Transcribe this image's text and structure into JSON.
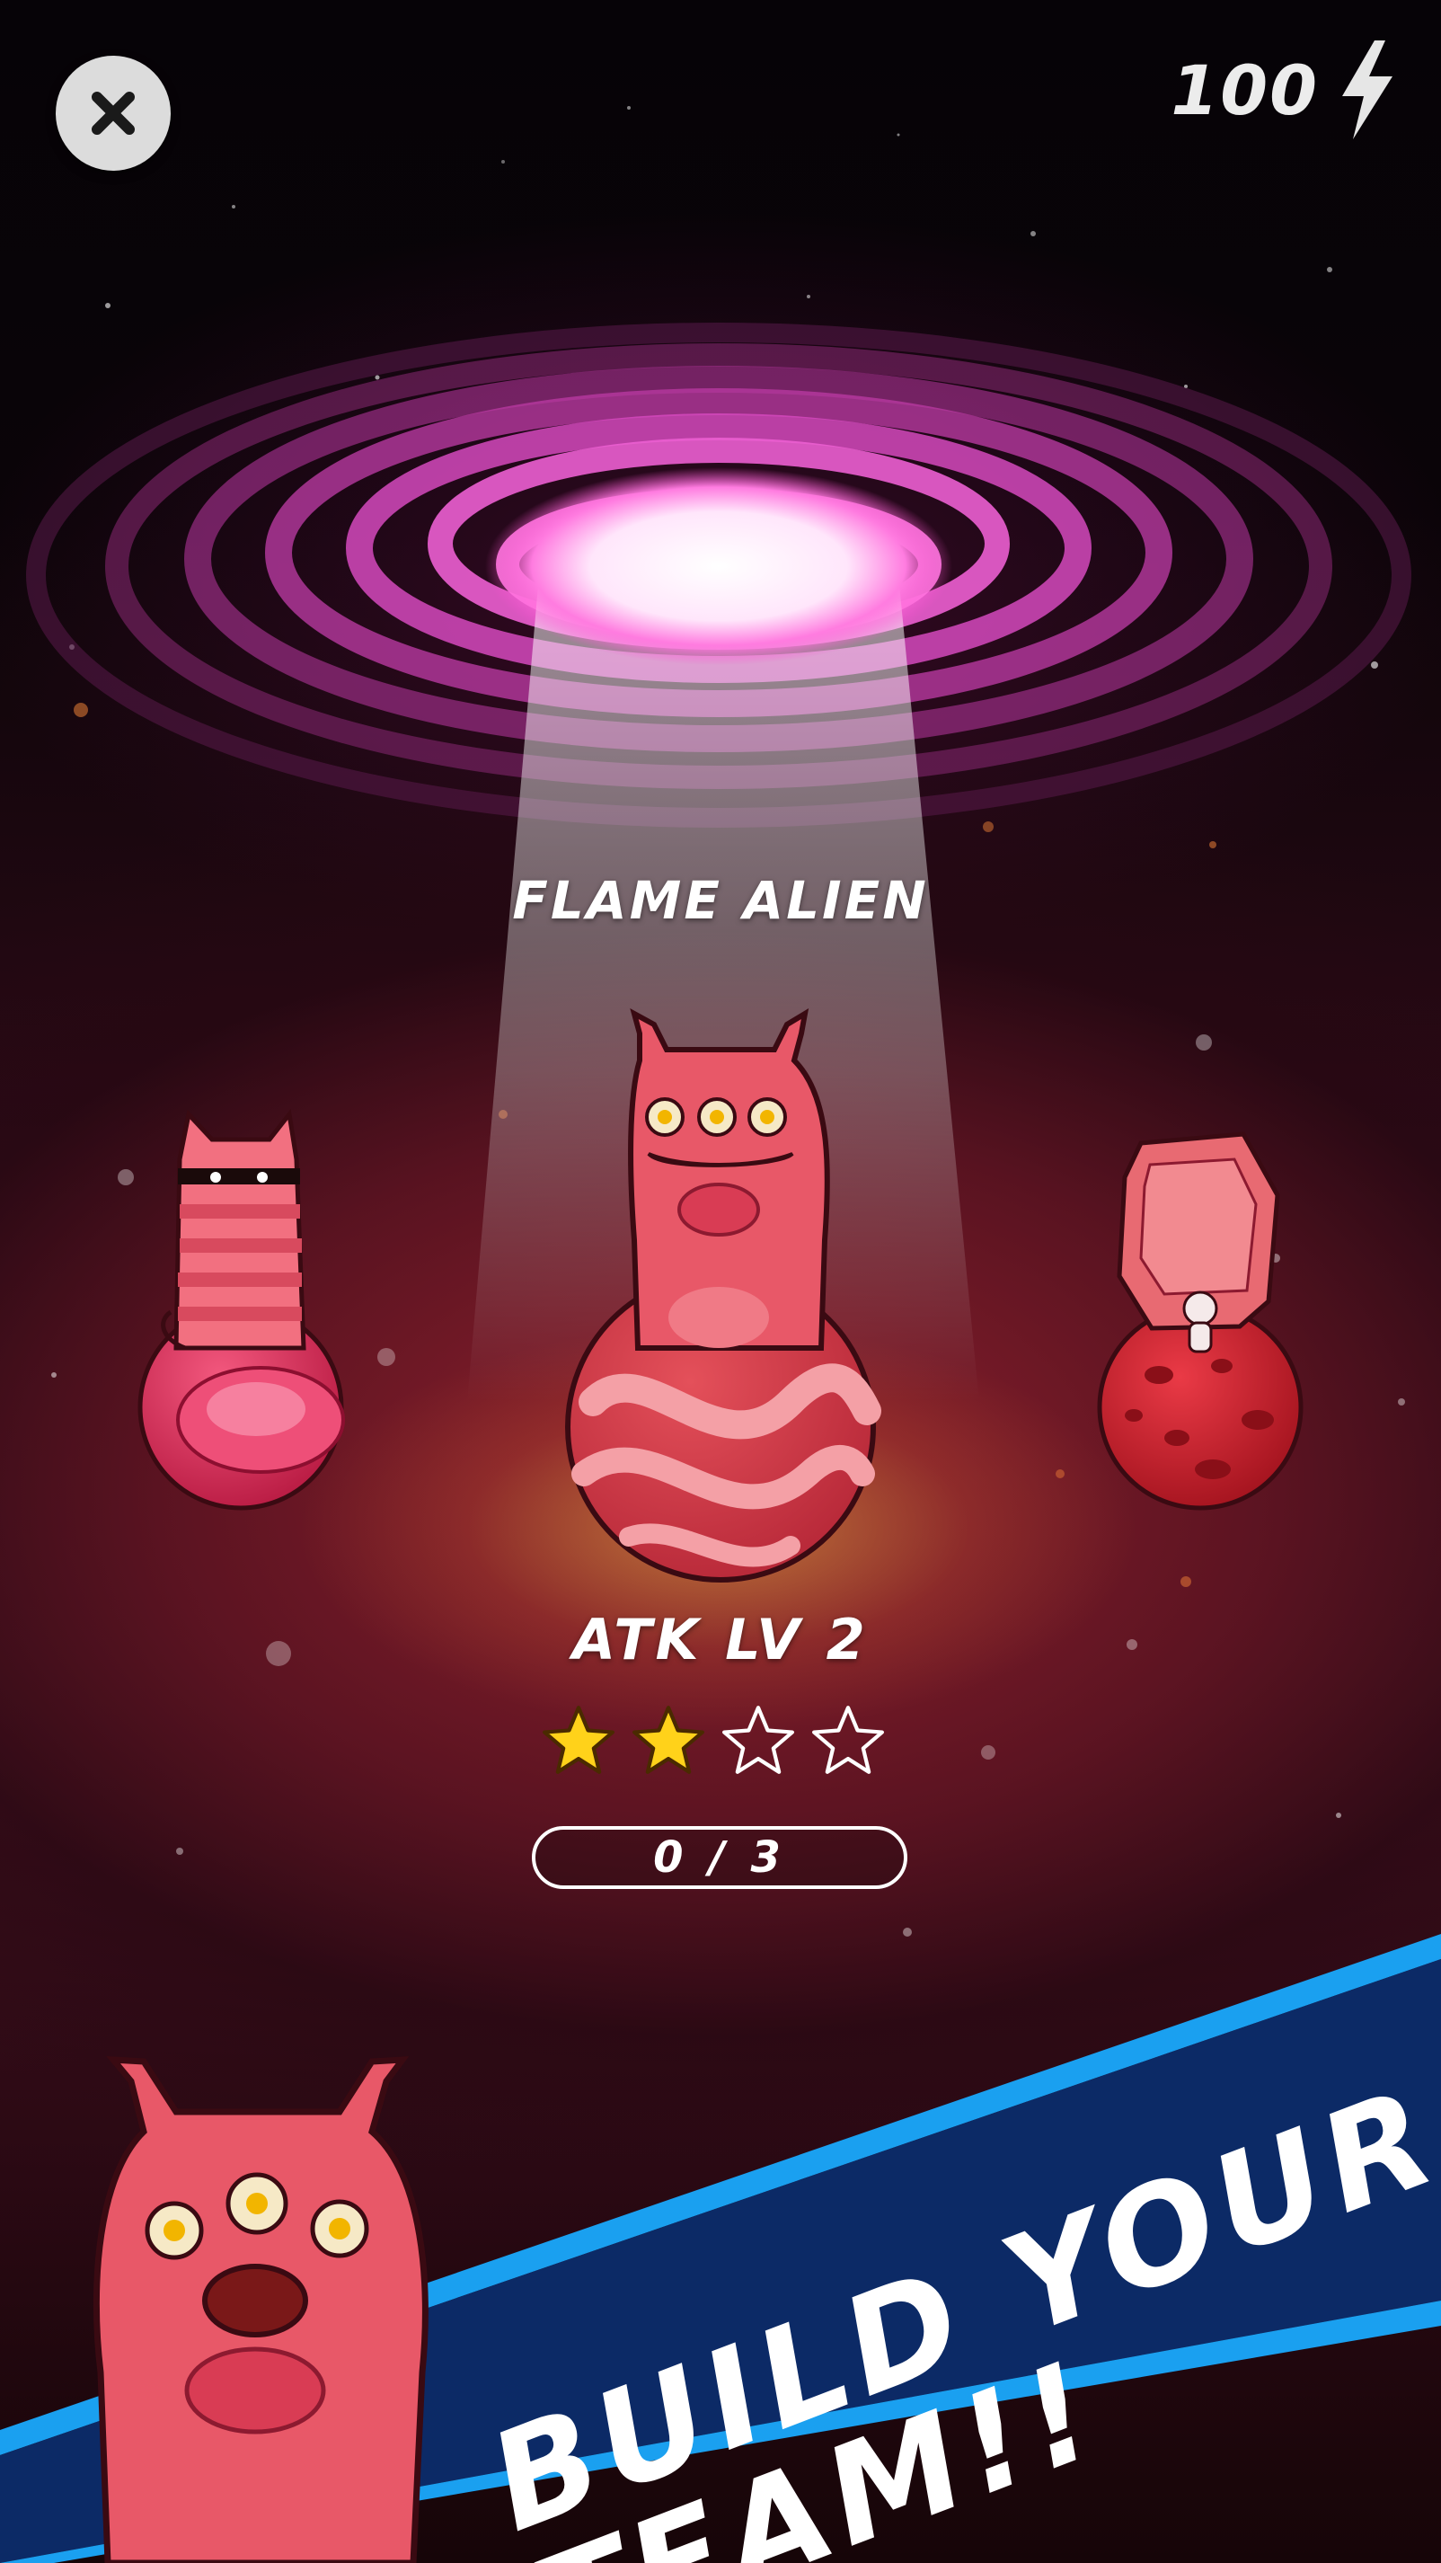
{
  "hud": {
    "close_icon": "close-icon",
    "energy_value": "100",
    "energy_icon": "lightning-bolt-icon"
  },
  "character": {
    "name": "FLAME ALIEN",
    "level_label": "ATK LV 2",
    "stars_total": 4,
    "stars_filled": 2,
    "star_filled_color": "#ffd21a",
    "progress_text": "0 / 3",
    "progress_current": 0,
    "progress_max": 3
  },
  "roster": [
    {
      "name": "striped-cat-alien",
      "planet": "pink-bubble-planet"
    },
    {
      "name": "flame-alien",
      "planet": "swirl-planet",
      "selected": true
    },
    {
      "name": "rock-golem-alien",
      "planet": "crater-planet"
    }
  ],
  "promo": {
    "line1": "BUILD YOUR",
    "line2": "TEAM!!",
    "band_color": "#0c2a66",
    "band_edge_color": "#1aa0f0"
  },
  "colors": {
    "portal_glow": "#ff6ad8",
    "alien_body": "#e85868",
    "planet_red": "#d8303e"
  }
}
